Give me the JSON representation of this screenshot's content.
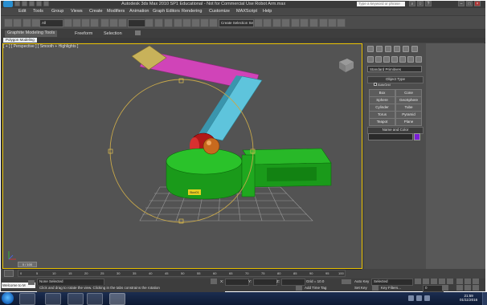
{
  "window": {
    "title": "Autodesk 3ds Max 2010 SP1  Educational - Not for Commercial Use     Robot Arm.max",
    "search_placeholder": "Type a keyword or phrase"
  },
  "menu": [
    "Edit",
    "Tools",
    "Group",
    "Views",
    "Create",
    "Modifiers",
    "Animation",
    "Graph Editors",
    "Rendering",
    "Customize",
    "MAXScript",
    "Help"
  ],
  "toolbar": {
    "selection_filter": "All",
    "named_selection": "Create Selection Se"
  },
  "ribbon": {
    "tabs": [
      "Graphite Modeling Tools",
      "Freeform",
      "Selection"
    ],
    "panel_label": "Polygon Modeling"
  },
  "viewport": {
    "label": "[ + ] [ Perspective ] [ Smooth + Highlights ]",
    "selected_object_label": "Box01"
  },
  "command_panel": {
    "category": "Standard Primitives",
    "object_type_header": "Object Type",
    "autogrid": "AutoGrid",
    "primitives": [
      "Box",
      "Cone",
      "Sphere",
      "GeoSphere",
      "Cylinder",
      "Tube",
      "Torus",
      "Pyramid",
      "Teapot",
      "Plane"
    ],
    "name_color_header": "Name and Color",
    "object_color": "#7a1fd6"
  },
  "timeline": {
    "slider_label": "0 / 100",
    "ticks": [
      "0",
      "5",
      "10",
      "15",
      "20",
      "25",
      "30",
      "35",
      "40",
      "45",
      "50",
      "55",
      "60",
      "65",
      "70",
      "75",
      "80",
      "85",
      "90",
      "95",
      "100"
    ]
  },
  "status": {
    "selection": "None Selected",
    "prompt": "Click and drag to rotate the view.  Clicking in the tabs constrains the rotation",
    "x_label": "X:",
    "y_label": "Y:",
    "z_label": "Z:",
    "grid": "Grid = 10.0",
    "add_time_tag": "Add Time Tag",
    "auto_key": "Auto Key",
    "set_key": "Set Key",
    "key_mode": "Selected",
    "key_filters": "Key Filters...",
    "frame": "0",
    "maxscript": "Welcome to M"
  },
  "taskbar": {
    "time": "21:59",
    "date": "01/11/2016"
  }
}
